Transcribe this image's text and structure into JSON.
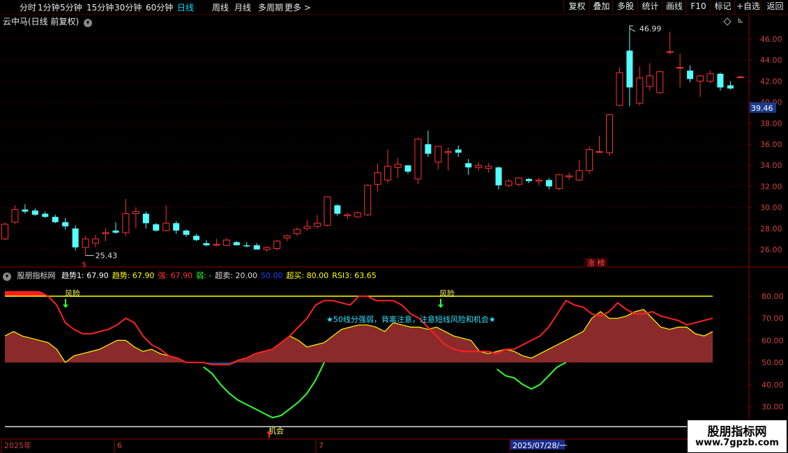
{
  "toolbar": {
    "timeframes": [
      "分时",
      "1分钟",
      "5分钟",
      "15分钟",
      "30分钟",
      "60分钟",
      "日线",
      "周线",
      "月线",
      "多周期",
      "更多 >"
    ],
    "active_index": 6,
    "right_buttons": [
      "复权",
      "叠加",
      "多股",
      "统计",
      "画线",
      "F10",
      "标记",
      "+自选",
      "返回"
    ]
  },
  "main_title": "云中马(日线 前复权)",
  "main_icon": "chevron-down-icon",
  "price_axis": {
    "ticks": [
      "46.00",
      "44.00",
      "42.00",
      "40.00",
      "38.00",
      "36.00",
      "34.00",
      "32.00",
      "30.00",
      "28.00",
      "26.00"
    ],
    "current_price": "39.46"
  },
  "annotations": {
    "high": "46.99",
    "low": "25.43",
    "zhangting": "涨 榜"
  },
  "indicator": {
    "name": "股朋指标网",
    "legend": [
      {
        "text": "趋势1: 67.90",
        "color": "#ffffff"
      },
      {
        "text": "趋势: 67.90",
        "color": "#ffff00"
      },
      {
        "text": "强: 67.90",
        "color": "#ff3030"
      },
      {
        "text": "弱: -",
        "color": "#30ff30"
      },
      {
        "text": "超卖: 20.00",
        "color": "#dddddd"
      },
      {
        "text": "50.00",
        "color": "#2040ff"
      },
      {
        "text": "超买: 80.00",
        "color": "#ffff00"
      },
      {
        "text": "RSI3: 63.65",
        "color": "#ffff00"
      }
    ],
    "axis_ticks": [
      "80.00",
      "70.00",
      "60.00",
      "50.00",
      "40.00",
      "30.00"
    ],
    "labels": {
      "risk1": "风险",
      "risk2": "风险",
      "opportunity": "机会",
      "note": "★50线分强弱，背离注意，注意短线风险和机会★"
    }
  },
  "date_axis": {
    "labels": [
      "2025年",
      "6",
      "7",
      "2025/07/28/一"
    ]
  },
  "watermark": {
    "title": "股朋指标网",
    "url": "www.7gpzb.com"
  },
  "colors": {
    "up": "#ff3232",
    "down": "#54ffff",
    "rsi": "#ffff00",
    "strong": "#ff2020",
    "weak": "#30ff30",
    "fill": "#8b2a2a"
  },
  "chart_data": [
    {
      "type": "candlestick",
      "title": "云中马(日线 前复权)",
      "ylim": [
        25,
        47.5
      ],
      "ohlc": [
        [
          27.0,
          28.6,
          26.9,
          28.4
        ],
        [
          28.6,
          30.2,
          28.4,
          29.8
        ],
        [
          29.8,
          30.3,
          29.4,
          29.6
        ],
        [
          29.7,
          29.9,
          29.2,
          29.3
        ],
        [
          29.4,
          29.6,
          29.0,
          29.1
        ],
        [
          29.1,
          29.3,
          28.5,
          28.6
        ],
        [
          28.6,
          29.0,
          27.9,
          28.2
        ],
        [
          28.0,
          28.3,
          25.9,
          26.2
        ],
        [
          26.2,
          27.3,
          25.43,
          27.0
        ],
        [
          26.6,
          27.4,
          26.2,
          27.0
        ],
        [
          27.5,
          28.0,
          26.8,
          27.6
        ],
        [
          27.8,
          28.6,
          27.5,
          27.6
        ],
        [
          27.6,
          30.8,
          27.3,
          29.4
        ],
        [
          29.4,
          30.0,
          28.0,
          29.6
        ],
        [
          29.4,
          29.6,
          28.0,
          28.5
        ],
        [
          28.4,
          28.5,
          27.7,
          27.8
        ],
        [
          27.8,
          30.2,
          27.7,
          28.5
        ],
        [
          28.5,
          28.7,
          27.5,
          27.8
        ],
        [
          27.8,
          27.9,
          27.2,
          27.4
        ],
        [
          27.3,
          27.5,
          26.8,
          26.9
        ],
        [
          26.6,
          26.9,
          26.3,
          26.4
        ],
        [
          26.4,
          27.0,
          26.3,
          26.5
        ],
        [
          26.4,
          27.1,
          26.3,
          26.9
        ],
        [
          26.7,
          26.8,
          26.4,
          26.4
        ],
        [
          26.4,
          26.7,
          26.2,
          26.3
        ],
        [
          26.4,
          26.6,
          26.0,
          26.0
        ],
        [
          26.0,
          26.3,
          25.8,
          26.2
        ],
        [
          26.1,
          26.9,
          25.9,
          26.8
        ],
        [
          27.1,
          27.4,
          26.8,
          27.3
        ],
        [
          27.5,
          28.1,
          27.3,
          27.9
        ],
        [
          28.0,
          28.8,
          27.8,
          28.2
        ],
        [
          28.2,
          29.3,
          28.0,
          28.5
        ],
        [
          28.3,
          31.0,
          28.2,
          31.0
        ],
        [
          30.2,
          30.3,
          29.2,
          29.4
        ],
        [
          29.2,
          29.5,
          28.9,
          29.3
        ],
        [
          29.1,
          29.6,
          29.0,
          29.5
        ],
        [
          29.3,
          32.2,
          29.2,
          32.1
        ],
        [
          32.2,
          34.2,
          31.5,
          33.3
        ],
        [
          32.6,
          35.5,
          32.3,
          33.9
        ],
        [
          33.8,
          34.7,
          32.8,
          34.1
        ],
        [
          34.0,
          34.0,
          33.2,
          33.4
        ],
        [
          32.7,
          36.6,
          32.2,
          36.5
        ],
        [
          36.0,
          37.3,
          34.8,
          35.1
        ],
        [
          34.3,
          35.7,
          33.6,
          35.8
        ],
        [
          35.2,
          35.7,
          33.5,
          35.3
        ],
        [
          35.5,
          35.9,
          34.8,
          35.2
        ],
        [
          34.2,
          34.6,
          33.1,
          33.8
        ],
        [
          33.8,
          34.3,
          33.5,
          34.0
        ],
        [
          33.7,
          34.2,
          33.3,
          33.9
        ],
        [
          33.8,
          33.9,
          31.7,
          32.1
        ],
        [
          32.1,
          32.7,
          31.9,
          32.5
        ],
        [
          32.2,
          32.9,
          32.0,
          32.8
        ],
        [
          32.7,
          32.8,
          32.3,
          32.5
        ],
        [
          32.5,
          32.8,
          32.1,
          32.6
        ],
        [
          32.6,
          32.8,
          31.7,
          32.0
        ],
        [
          31.8,
          33.2,
          31.6,
          33.1
        ],
        [
          32.9,
          33.3,
          32.6,
          33.0
        ],
        [
          32.6,
          34.5,
          32.5,
          33.5
        ],
        [
          33.5,
          35.8,
          33.2,
          35.5
        ],
        [
          35.3,
          36.8,
          35.2,
          35.3
        ],
        [
          35.2,
          38.9,
          34.9,
          38.8
        ],
        [
          39.7,
          43.3,
          39.6,
          42.8
        ],
        [
          44.9,
          46.99,
          39.6,
          41.4
        ],
        [
          39.9,
          43.4,
          39.7,
          42.3
        ],
        [
          41.5,
          43.7,
          41.1,
          42.5
        ],
        [
          40.9,
          43.0,
          40.8,
          42.9
        ],
        [
          44.8,
          46.7,
          44.5,
          44.8
        ],
        [
          43.3,
          44.6,
          41.4,
          43.3
        ],
        [
          43.0,
          43.5,
          41.9,
          42.2
        ],
        [
          42.0,
          42.6,
          40.5,
          42.5
        ],
        [
          42.0,
          43.0,
          41.8,
          42.7
        ],
        [
          42.7,
          42.8,
          41.1,
          41.4
        ],
        [
          41.6,
          42.0,
          41.2,
          41.3
        ],
        [
          42.4,
          42.5,
          42.3,
          42.4
        ]
      ]
    },
    {
      "type": "line",
      "ylim": [
        25,
        90
      ],
      "series": [
        {
          "name": "RSI3",
          "values": [
            62,
            64,
            62,
            61,
            60,
            59,
            56,
            50,
            53,
            54,
            55,
            56,
            58,
            60,
            60,
            57,
            55,
            56,
            54,
            53,
            52,
            50,
            50,
            50,
            49,
            49,
            49,
            51,
            52,
            54,
            55,
            56,
            59,
            62,
            60,
            57,
            58,
            59,
            62,
            65,
            66,
            67,
            67,
            66,
            64,
            68,
            67,
            66,
            66,
            65,
            66,
            64,
            62,
            61,
            60,
            55,
            54,
            55,
            56,
            55,
            53,
            52,
            54,
            56,
            58,
            60,
            62,
            64,
            70,
            73,
            70,
            70,
            71,
            73,
            74,
            70,
            66,
            65,
            66,
            66,
            63,
            62,
            64
          ]
        },
        {
          "name": "强",
          "values": [
            82,
            82,
            82,
            82,
            82,
            80,
            76,
            68,
            65,
            63,
            63,
            64,
            65,
            67,
            70,
            68,
            62,
            58,
            56,
            53,
            52,
            50,
            50,
            50,
            49,
            49,
            49,
            51,
            52,
            54,
            55,
            56,
            59,
            62,
            66,
            70,
            76,
            78,
            78,
            77,
            76,
            80,
            80,
            78,
            78,
            78,
            76,
            72,
            70,
            66,
            62,
            58,
            56,
            55,
            55,
            55,
            55,
            54,
            56,
            56,
            58,
            60,
            62,
            66,
            72,
            78,
            76,
            75,
            72,
            71,
            73,
            77,
            74,
            72,
            72,
            73,
            71,
            70,
            69,
            67,
            68,
            69,
            70
          ]
        },
        {
          "name": "弱",
          "values": [
            null,
            null,
            null,
            null,
            null,
            null,
            null,
            null,
            null,
            null,
            null,
            null,
            null,
            null,
            null,
            null,
            null,
            null,
            null,
            null,
            null,
            null,
            null,
            48,
            45,
            40,
            36,
            33,
            31,
            29,
            27,
            25,
            26,
            29,
            32,
            36,
            42,
            50,
            null,
            null,
            null,
            null,
            null,
            null,
            null,
            null,
            null,
            null,
            null,
            null,
            null,
            null,
            null,
            null,
            null,
            null,
            null,
            47,
            44,
            43,
            40,
            38,
            40,
            44,
            48,
            50
          ]
        }
      ],
      "overbought": 80,
      "oversold": 20,
      "midline": 50
    }
  ]
}
